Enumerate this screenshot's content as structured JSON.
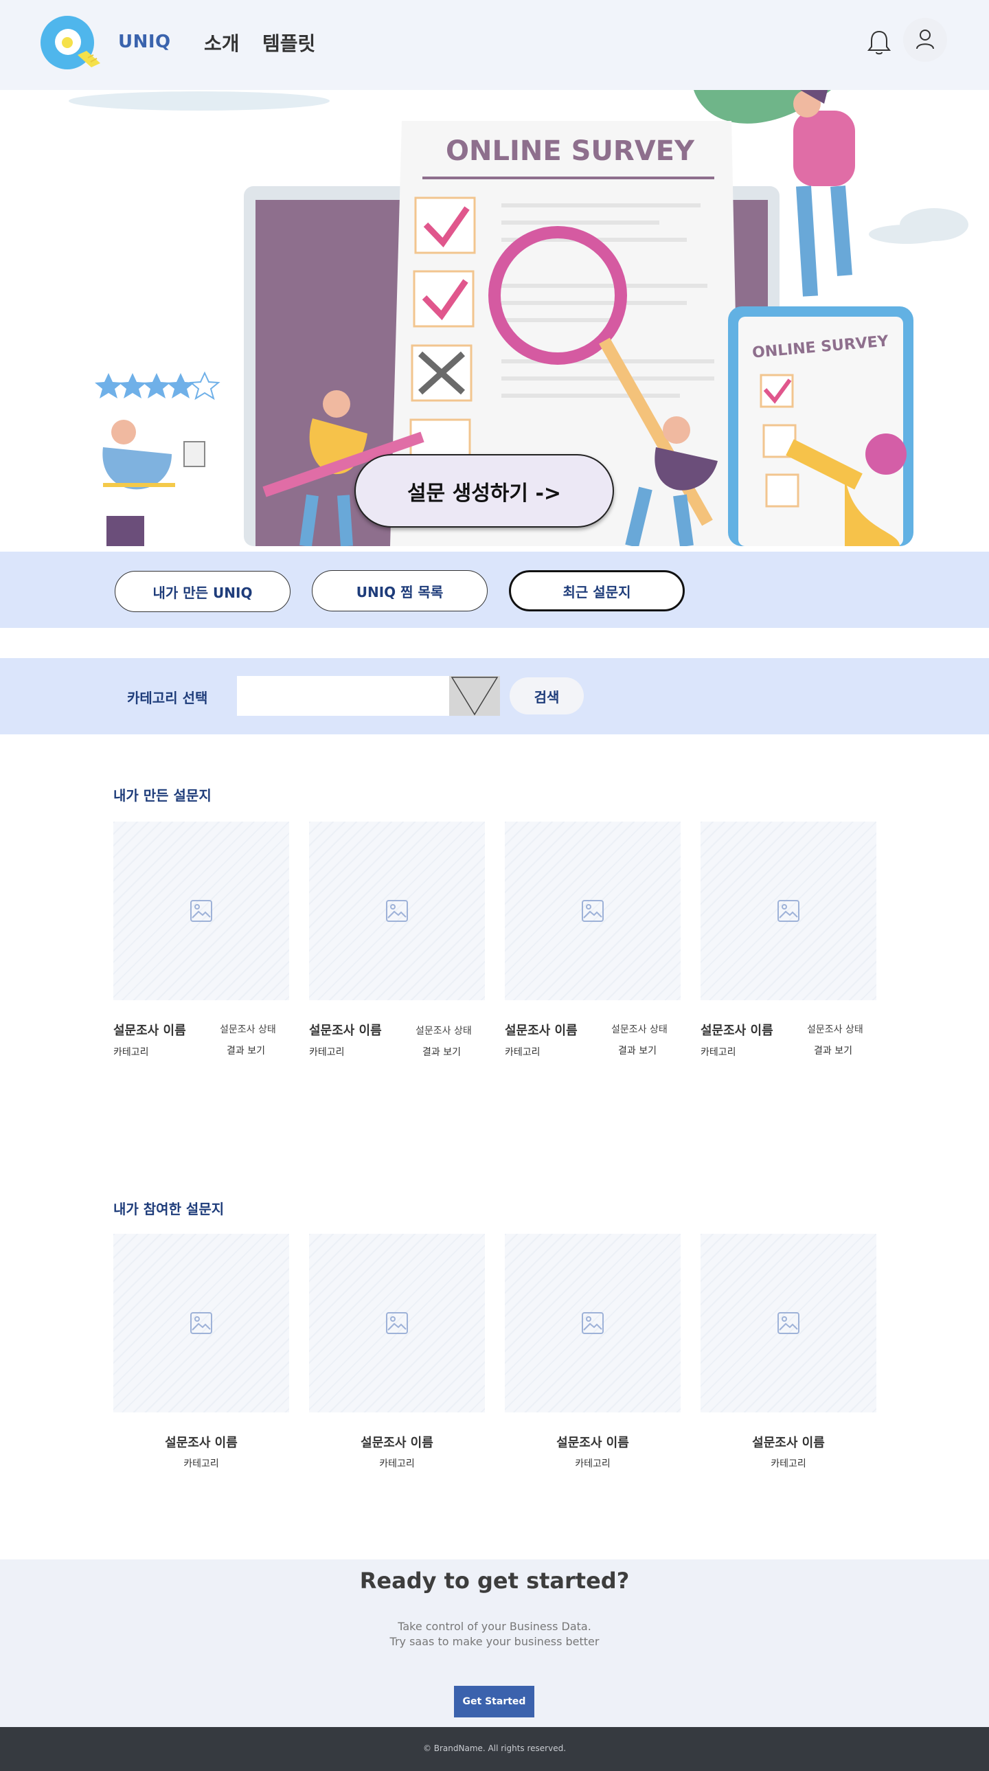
{
  "header": {
    "brand": "UNIQ",
    "nav": [
      "소개",
      "템플릿"
    ]
  },
  "hero": {
    "survey_title": "ONLINE SURVEY",
    "phone_title": "ONLINE SURVEY",
    "create_button": "설문 생성하기 ->",
    "rating_stars": 4
  },
  "tabs": [
    "내가 만든 UNIQ",
    "UNIQ 찜 목록",
    "최근 설문지"
  ],
  "category": {
    "label": "카테고리 선택",
    "selected": "",
    "search_button": "검색"
  },
  "my_surveys": {
    "title": "내가 만든 설문지",
    "cards": [
      {
        "name": "설문조사 이름",
        "status": "설문조사 상태",
        "category": "카테고리",
        "result": "결과 보기"
      },
      {
        "name": "설문조사 이름",
        "status": "설문조사 상태",
        "category": "카테고리",
        "result": "결과 보기"
      },
      {
        "name": "설문조사 이름",
        "status": "설문조사 상태",
        "category": "카테고리",
        "result": "결과 보기"
      },
      {
        "name": "설문조사 이름",
        "status": "설문조사 상태",
        "category": "카테고리",
        "result": "결과 보기"
      }
    ]
  },
  "joined_surveys": {
    "title": "내가 참여한 설문지",
    "cards": [
      {
        "name": "설문조사 이름",
        "category": "카테고리"
      },
      {
        "name": "설문조사 이름",
        "category": "카테고리"
      },
      {
        "name": "설문조사 이름",
        "category": "카테고리"
      },
      {
        "name": "설문조사 이름",
        "category": "카테고리"
      }
    ]
  },
  "cta": {
    "title": "Ready to get started?",
    "line1": "Take control of your Business Data.",
    "line2": "Try saas to make your business better",
    "button": "Get Started"
  },
  "footer": {
    "text": "© BrandName. All rights reserved."
  },
  "colors": {
    "brand": "#3a63ad",
    "band": "#dbe5fb",
    "accent_text": "#1e3c7a",
    "cta_button": "#3b62ad"
  }
}
